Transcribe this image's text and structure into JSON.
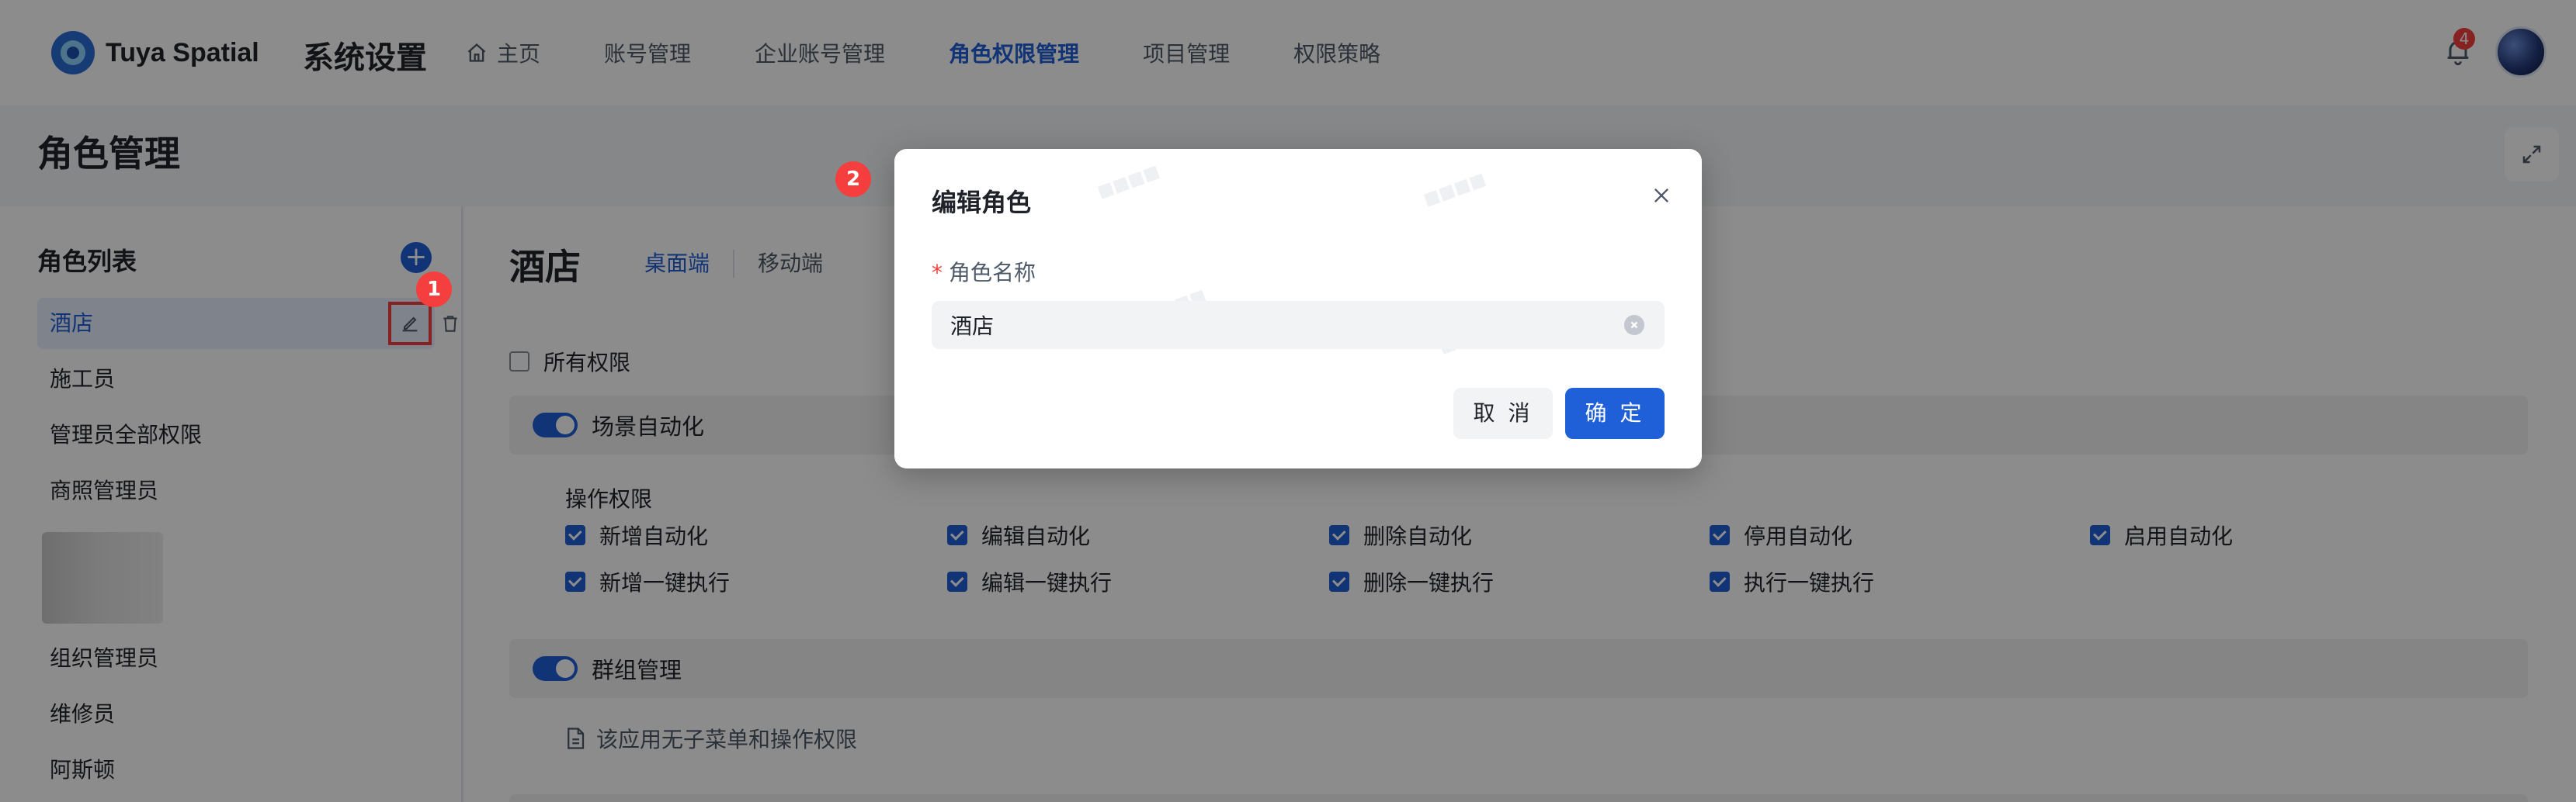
{
  "topnav": {
    "brand": "Tuya Spatial",
    "system_title": "系统设置",
    "items": [
      {
        "label": "主页",
        "icon": "home-icon",
        "active": false
      },
      {
        "label": "账号管理",
        "active": false
      },
      {
        "label": "企业账号管理",
        "active": false
      },
      {
        "label": "角色权限管理",
        "active": true
      },
      {
        "label": "项目管理",
        "active": false
      },
      {
        "label": "权限策略",
        "active": false
      }
    ],
    "notification_count": "4"
  },
  "page": {
    "title": "角色管理"
  },
  "sidebar": {
    "title": "角色列表",
    "roles": [
      "酒店",
      "施工员",
      "管理员全部权限",
      "商照管理员",
      "组织管理员",
      "维修员",
      "阿斯顿"
    ],
    "selected": "酒店"
  },
  "main": {
    "title": "酒店",
    "tabs": [
      "桌面端",
      "移动端"
    ],
    "all_permissions_label": "所有权限",
    "sections": [
      {
        "name": "场景自动化",
        "op_label": "操作权限",
        "permissions": [
          [
            "新增自动化",
            "编辑自动化",
            "删除自动化",
            "停用自动化",
            "启用自动化"
          ],
          [
            "新增一键执行",
            "编辑一键执行",
            "删除一键执行",
            "执行一键执行"
          ]
        ]
      },
      {
        "name": "群组管理",
        "note": "该应用无子菜单和操作权限"
      }
    ]
  },
  "annotations": {
    "step1": "1",
    "step2": "2"
  },
  "modal": {
    "title": "编辑角色",
    "field_required_mark": "*",
    "field_label": "角色名称",
    "field_value": "酒店",
    "cancel_label": "取 消",
    "confirm_label": "确 定"
  },
  "colors": {
    "accent": "#1f5fd8",
    "annotation_red": "#f53f3f",
    "overlay": "rgba(0,0,0,0.45)"
  }
}
